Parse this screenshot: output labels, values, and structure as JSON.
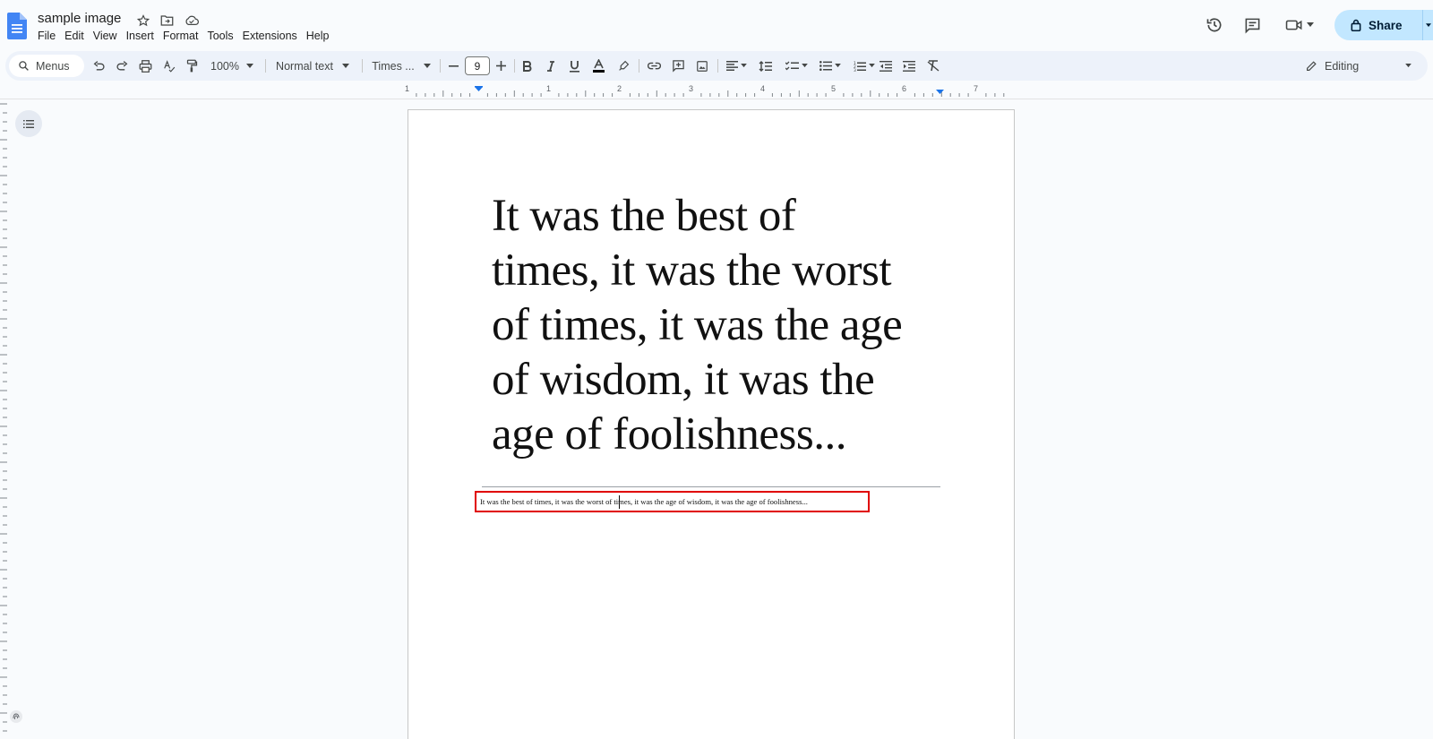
{
  "document": {
    "title": "sample image"
  },
  "menu": [
    "File",
    "Edit",
    "View",
    "Insert",
    "Format",
    "Tools",
    "Extensions",
    "Help"
  ],
  "header_actions": {
    "share_label": "Share"
  },
  "toolbar": {
    "search_label": "Menus",
    "zoom": "100%",
    "style": "Normal text",
    "font": "Times ...",
    "font_size": "9",
    "mode": "Editing",
    "icons": [
      "undo-icon",
      "redo-icon",
      "print-icon",
      "spellcheck-icon",
      "paint-format-icon",
      "bold-icon",
      "italic-icon",
      "underline-icon",
      "text-color-icon",
      "highlight-icon",
      "link-icon",
      "add-comment-icon",
      "insert-image-icon",
      "align-icon",
      "line-spacing-icon",
      "checklist-icon",
      "bulleted-list-icon",
      "numbered-list-icon",
      "decrease-indent-icon",
      "increase-indent-icon",
      "clear-formatting-icon"
    ]
  },
  "ruler": {
    "marks": [
      "1",
      "1",
      "2",
      "3",
      "4",
      "5",
      "6",
      "7"
    ]
  },
  "content": {
    "image_text_lines": [
      "It was the best of",
      "times, it was the worst",
      "of times, it was the age",
      "of wisdom, it was the",
      "age of foolishness..."
    ],
    "paragraph": "It was the best of times, it was the worst of times, it was the age of wisdom, it was the age of foolishness..."
  },
  "colors": {
    "share_bg": "#c2e7ff",
    "highlight_box": "#e00000",
    "toolbar_bg": "#edf2fa"
  }
}
